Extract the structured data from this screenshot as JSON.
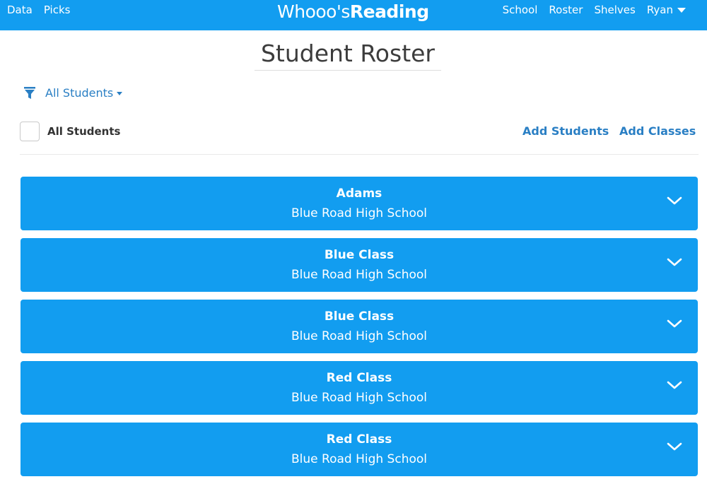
{
  "header": {
    "nav_left": [
      {
        "label": "Data"
      },
      {
        "label": "Picks"
      }
    ],
    "logo": {
      "part1": "Whooo's",
      "part2": "Reading"
    },
    "nav_right": [
      {
        "label": "School"
      },
      {
        "label": "Roster"
      },
      {
        "label": "Shelves"
      }
    ],
    "user_menu_label": "Ryan",
    "bar_color": "#129df0"
  },
  "page": {
    "title": "Student Roster"
  },
  "filter": {
    "icon": "funnel-icon",
    "selected": "All Students"
  },
  "selection": {
    "label": "All Students",
    "checked": false
  },
  "actions": {
    "add_students": "Add Students",
    "add_classes": "Add Classes"
  },
  "classes": [
    {
      "name": "Adams",
      "school": "Blue Road High School"
    },
    {
      "name": "Blue Class",
      "school": "Blue Road High School"
    },
    {
      "name": "Blue Class",
      "school": "Blue Road High School"
    },
    {
      "name": "Red Class",
      "school": "Blue Road High School"
    },
    {
      "name": "Red Class",
      "school": "Blue Road High School"
    }
  ],
  "colors": {
    "accent": "#129df0",
    "link": "#2a7fc4"
  }
}
